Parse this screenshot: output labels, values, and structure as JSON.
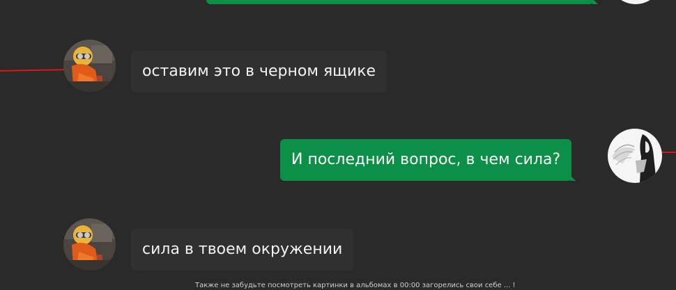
{
  "messages": [
    {
      "side": "outgoing",
      "text": ""
    },
    {
      "side": "incoming",
      "text": "оставим это в черном ящике",
      "avatar": "minion-avatar"
    },
    {
      "side": "outgoing",
      "text": "И последний вопрос, в чем сила?",
      "avatar": "sketch-avatar"
    },
    {
      "side": "incoming",
      "text": "сила в твоем окружении",
      "avatar": "minion-avatar"
    }
  ],
  "footer": {
    "text": "Также не забудьте посмотреть картинки в альбомах в 00:00 загорелись свои себе ... !"
  },
  "colors": {
    "background": "#2a2a2a",
    "incoming_bubble": "#303030",
    "outgoing_bubble": "#0c8f47",
    "connector_line": "#e01515"
  }
}
